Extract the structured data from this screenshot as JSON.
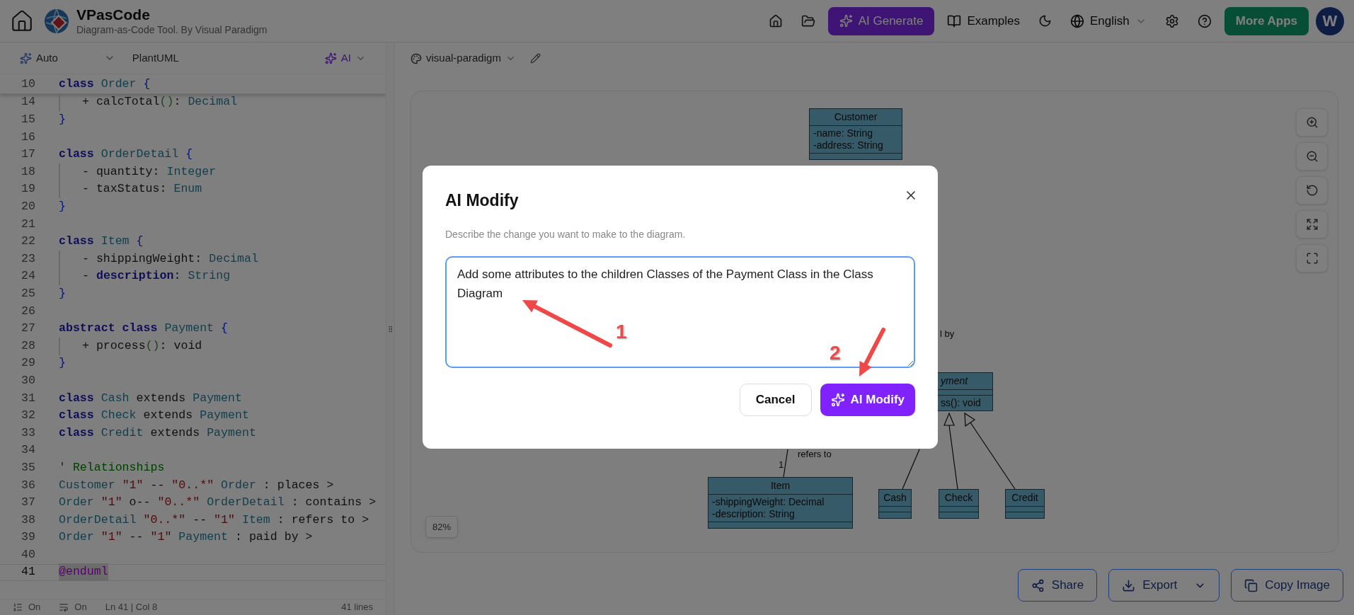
{
  "header": {
    "title": "VPasCode",
    "subtitle": "Diagram-as-Code Tool. By Visual Paradigm",
    "nav": [
      {
        "kind": "primary",
        "label": "AI Generate"
      },
      {
        "kind": "plain",
        "label": "Examples"
      },
      {
        "kind": "select",
        "label": "English"
      },
      {
        "kind": "accent",
        "label": "More Apps"
      }
    ],
    "avatar": "W"
  },
  "editor": {
    "toolbar": {
      "mode": "Auto",
      "language": "PlantUML",
      "ai": "AI"
    },
    "sticky_line": {
      "number": "10",
      "tokens": [
        {
          "kind": "kw",
          "text": "class "
        },
        {
          "kind": "type",
          "text": "Order "
        },
        {
          "kind": "brace",
          "text": "{"
        }
      ]
    },
    "lines": [
      {
        "number": "14",
        "current": false,
        "indented": true,
        "tokens": [
          {
            "kind": "text",
            "text": "+ calcTotal"
          },
          {
            "kind": "paren",
            "text": "()"
          },
          {
            "kind": "text",
            "text": ": "
          },
          {
            "kind": "type",
            "text": "Decimal"
          }
        ]
      },
      {
        "number": "15",
        "current": false,
        "indented": false,
        "tokens": [
          {
            "kind": "brace",
            "text": "}"
          }
        ]
      },
      {
        "number": "16",
        "current": false
      },
      {
        "number": "17",
        "current": false,
        "indented": false,
        "tokens": [
          {
            "kind": "kw",
            "text": "class "
          },
          {
            "kind": "type",
            "text": "OrderDetail "
          },
          {
            "kind": "brace",
            "text": "{"
          }
        ]
      },
      {
        "number": "18",
        "current": false,
        "indented": true,
        "tokens": [
          {
            "kind": "text",
            "text": "- quantity: "
          },
          {
            "kind": "type",
            "text": "Integer"
          }
        ]
      },
      {
        "number": "19",
        "current": false,
        "indented": true,
        "tokens": [
          {
            "kind": "text",
            "text": "- taxStatus: "
          },
          {
            "kind": "type",
            "text": "Enum"
          }
        ]
      },
      {
        "number": "20",
        "current": false,
        "indented": false,
        "tokens": [
          {
            "kind": "brace",
            "text": "}"
          }
        ]
      },
      {
        "number": "21",
        "current": false
      },
      {
        "number": "22",
        "current": false,
        "indented": false,
        "tokens": [
          {
            "kind": "kw",
            "text": "class "
          },
          {
            "kind": "type",
            "text": "Item "
          },
          {
            "kind": "brace",
            "text": "{"
          }
        ]
      },
      {
        "number": "23",
        "current": false,
        "indented": true,
        "tokens": [
          {
            "kind": "text",
            "text": "- shippingWeight: "
          },
          {
            "kind": "type",
            "text": "Decimal"
          }
        ]
      },
      {
        "number": "24",
        "current": false,
        "indented": true,
        "tokens": [
          {
            "kind": "text",
            "text": "- "
          },
          {
            "kind": "kw",
            "text": "description"
          },
          {
            "kind": "text",
            "text": ": "
          },
          {
            "kind": "type",
            "text": "String"
          }
        ]
      },
      {
        "number": "25",
        "current": false,
        "indented": false,
        "tokens": [
          {
            "kind": "brace",
            "text": "}"
          }
        ]
      },
      {
        "number": "26",
        "current": false
      },
      {
        "number": "27",
        "current": false,
        "indented": false,
        "tokens": [
          {
            "kind": "kw",
            "text": "abstract class "
          },
          {
            "kind": "type",
            "text": "Payment "
          },
          {
            "kind": "brace",
            "text": "{"
          }
        ]
      },
      {
        "number": "28",
        "current": false,
        "indented": true,
        "tokens": [
          {
            "kind": "text",
            "text": "+ process"
          },
          {
            "kind": "paren",
            "text": "()"
          },
          {
            "kind": "text",
            "text": ": void"
          }
        ]
      },
      {
        "number": "29",
        "current": false,
        "indented": false,
        "tokens": [
          {
            "kind": "brace",
            "text": "}"
          }
        ]
      },
      {
        "number": "30",
        "current": false
      },
      {
        "number": "31",
        "current": false,
        "indented": false,
        "tokens": [
          {
            "kind": "kw",
            "text": "class "
          },
          {
            "kind": "type",
            "text": "Cash "
          },
          {
            "kind": "text",
            "text": "extends "
          },
          {
            "kind": "type",
            "text": "Payment"
          }
        ]
      },
      {
        "number": "32",
        "current": false,
        "indented": false,
        "tokens": [
          {
            "kind": "kw",
            "text": "class "
          },
          {
            "kind": "type",
            "text": "Check "
          },
          {
            "kind": "text",
            "text": "extends "
          },
          {
            "kind": "type",
            "text": "Payment"
          }
        ]
      },
      {
        "number": "33",
        "current": false,
        "indented": false,
        "tokens": [
          {
            "kind": "kw",
            "text": "class "
          },
          {
            "kind": "type",
            "text": "Credit "
          },
          {
            "kind": "text",
            "text": "extends "
          },
          {
            "kind": "type",
            "text": "Payment"
          }
        ]
      },
      {
        "number": "34",
        "current": false
      },
      {
        "number": "35",
        "current": false,
        "indented": false,
        "tokens": [
          {
            "kind": "comment",
            "text": "' Relationships"
          }
        ]
      },
      {
        "number": "36",
        "current": false,
        "indented": false,
        "tokens": [
          {
            "kind": "type",
            "text": "Customer "
          },
          {
            "kind": "str",
            "text": "\"1\""
          },
          {
            "kind": "text",
            "text": " -- "
          },
          {
            "kind": "str",
            "text": "\"0..*\""
          },
          {
            "kind": "type",
            "text": " Order"
          },
          {
            "kind": "text",
            "text": " : places >"
          }
        ]
      },
      {
        "number": "37",
        "current": false,
        "indented": false,
        "tokens": [
          {
            "kind": "type",
            "text": "Order "
          },
          {
            "kind": "str",
            "text": "\"1\""
          },
          {
            "kind": "text",
            "text": " o-- "
          },
          {
            "kind": "str",
            "text": "\"0..*\""
          },
          {
            "kind": "type",
            "text": " OrderDetail"
          },
          {
            "kind": "text",
            "text": " : contains >"
          }
        ]
      },
      {
        "number": "38",
        "current": false,
        "indented": false,
        "tokens": [
          {
            "kind": "type",
            "text": "OrderDetail "
          },
          {
            "kind": "str",
            "text": "\"0..*\""
          },
          {
            "kind": "text",
            "text": " -- "
          },
          {
            "kind": "str",
            "text": "\"1\""
          },
          {
            "kind": "type",
            "text": " Item"
          },
          {
            "kind": "text",
            "text": " : refers to >"
          }
        ]
      },
      {
        "number": "39",
        "current": false,
        "indented": false,
        "tokens": [
          {
            "kind": "type",
            "text": "Order "
          },
          {
            "kind": "str",
            "text": "\"1\""
          },
          {
            "kind": "text",
            "text": " -- "
          },
          {
            "kind": "str",
            "text": "\"1\""
          },
          {
            "kind": "type",
            "text": " Payment"
          },
          {
            "kind": "text",
            "text": " : paid by >"
          }
        ]
      },
      {
        "number": "40",
        "current": false
      },
      {
        "number": "41",
        "current": true,
        "indented": false,
        "tokens": [
          {
            "kind": "directive",
            "text": "@enduml"
          }
        ]
      }
    ],
    "status": {
      "line_numbers": "On",
      "word_wrap": "On",
      "position": "Ln 41 | Col 8",
      "count": "41 lines"
    }
  },
  "preview": {
    "theme": "visual-paradigm",
    "zoom": "82%",
    "classes": [
      {
        "name": "Customer",
        "abstract": false,
        "attributes": [
          "-name: String",
          "-address: String"
        ]
      },
      {
        "name": "yment",
        "abstract": true,
        "methods": [
          "ss(): void"
        ]
      },
      {
        "name": "Item",
        "abstract": false,
        "attributes": [
          "-shippingWeight: Decimal",
          "-description: String"
        ]
      },
      {
        "name": "Cash",
        "abstract": false
      },
      {
        "name": "Check",
        "abstract": false
      },
      {
        "name": "Credit",
        "abstract": false
      }
    ],
    "labels": [
      "l by",
      "refers to",
      "1"
    ],
    "actions": [
      "Share",
      "Export",
      "Copy Image"
    ]
  },
  "dialog": {
    "title": "AI Modify",
    "description": "Describe the change you want to make to the diagram.",
    "value": "Add some attributes to the children Classes of the Payment Class in the Class Diagram",
    "buttons": [
      {
        "kind": "secondary",
        "label": "Cancel"
      },
      {
        "kind": "primary",
        "label": "AI Modify"
      }
    ]
  },
  "annotations": [
    {
      "number": "1"
    },
    {
      "number": "2"
    }
  ]
}
